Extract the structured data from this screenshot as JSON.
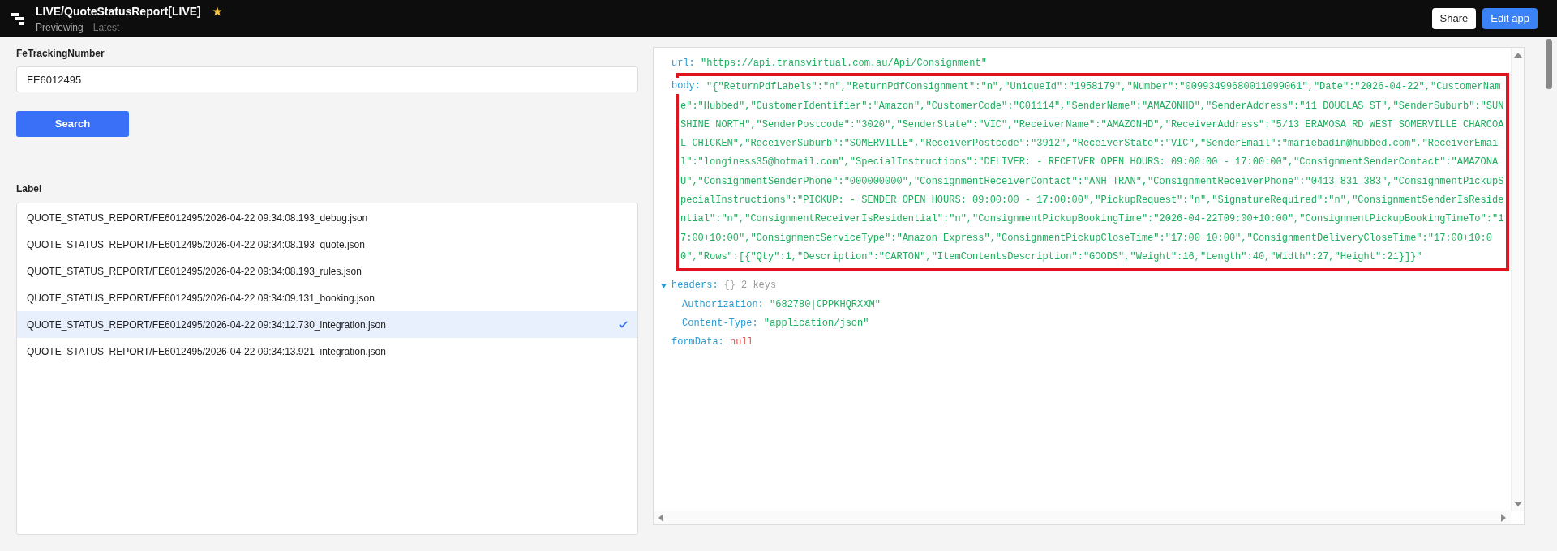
{
  "header": {
    "title": "LIVE/QuoteStatusReport[LIVE]",
    "starred": true,
    "mode": "Previewing",
    "version": "Latest",
    "buttons": [
      {
        "label": "Share",
        "kind": "secondary"
      },
      {
        "label": "Edit app",
        "kind": "primary"
      }
    ]
  },
  "form": {
    "field": {
      "label": "FeTrackingNumber",
      "value": "FE6012495"
    },
    "search_button": "Search"
  },
  "label_list": {
    "label": "Label",
    "items": [
      {
        "text": "QUOTE_STATUS_REPORT/FE6012495/2026-04-22 09:34:08.193_debug.json",
        "selected": false
      },
      {
        "text": "QUOTE_STATUS_REPORT/FE6012495/2026-04-22 09:34:08.193_quote.json",
        "selected": false
      },
      {
        "text": "QUOTE_STATUS_REPORT/FE6012495/2026-04-22 09:34:08.193_rules.json",
        "selected": false
      },
      {
        "text": "QUOTE_STATUS_REPORT/FE6012495/2026-04-22 09:34:09.131_booking.json",
        "selected": false
      },
      {
        "text": "QUOTE_STATUS_REPORT/FE6012495/2026-04-22 09:34:12.730_integration.json",
        "selected": true
      },
      {
        "text": "QUOTE_STATUS_REPORT/FE6012495/2026-04-22 09:34:13.921_integration.json",
        "selected": false
      }
    ]
  },
  "inspector": {
    "url": {
      "key": "url:",
      "value": "\"https://api.transvirtual.com.au/Api/Consignment\""
    },
    "body": {
      "key": "body:",
      "value": "\"{\"ReturnPdfLabels\":\"n\",\"ReturnPdfConsignment\":\"n\",\"UniqueId\":\"1958179\",\"Number\":\"00993499680011099061\",\"Date\":\"2026-04-22\",\"CustomerName\":\"Hubbed\",\"CustomerIdentifier\":\"Amazon\",\"CustomerCode\":\"C01114\",\"SenderName\":\"AMAZONHD\",\"SenderAddress\":\"11 DOUGLAS ST\",\"SenderSuburb\":\"SUNSHINE NORTH\",\"SenderPostcode\":\"3020\",\"SenderState\":\"VIC\",\"ReceiverName\":\"AMAZONHD\",\"ReceiverAddress\":\"5/13 ERAMOSA RD WEST SOMERVILLE CHARCOAL CHICKEN\",\"ReceiverSuburb\":\"SOMERVILLE\",\"ReceiverPostcode\":\"3912\",\"ReceiverState\":\"VIC\",\"SenderEmail\":\"mariebadin@hubbed.com\",\"ReceiverEmail\":\"longiness35@hotmail.com\",\"SpecialInstructions\":\"DELIVER: - RECEIVER OPEN HOURS: 09:00:00 - 17:00:00\",\"ConsignmentSenderContact\":\"AMAZONAU\",\"ConsignmentSenderPhone\":\"000000000\",\"ConsignmentReceiverContact\":\"ANH TRAN\",\"ConsignmentReceiverPhone\":\"0413 831 383\",\"ConsignmentPickupSpecialInstructions\":\"PICKUP: - SENDER OPEN HOURS: 09:00:00 - 17:00:00\",\"PickupRequest\":\"n\",\"SignatureRequired\":\"n\",\"ConsignmentSenderIsResidential\":\"n\",\"ConsignmentReceiverIsResidential\":\"n\",\"ConsignmentPickupBookingTime\":\"2026-04-22T09:00+10:00\",\"ConsignmentPickupBookingTimeTo\":\"17:00+10:00\",\"ConsignmentServiceType\":\"Amazon Express\",\"ConsignmentPickupCloseTime\":\"17:00+10:00\",\"ConsignmentDeliveryCloseTime\":\"17:00+10:00\",\"Rows\":[{\"Qty\":1,\"Description\":\"CARTON\",\"ItemContentsDescription\":\"GOODS\",\"Weight\":16,\"Length\":40,\"Width\":27,\"Height\":21}]}\"",
      "highlighted": true
    },
    "headers": {
      "key": "headers:",
      "expanded": true,
      "summary": "{}",
      "count": "2 keys",
      "entries": [
        {
          "key": "Authorization:",
          "value": "\"682780|CPPKHQRXXM\""
        },
        {
          "key": "Content-Type:",
          "value": "\"application/json\""
        }
      ]
    },
    "formData": {
      "key": "formData:",
      "value": "null"
    }
  }
}
